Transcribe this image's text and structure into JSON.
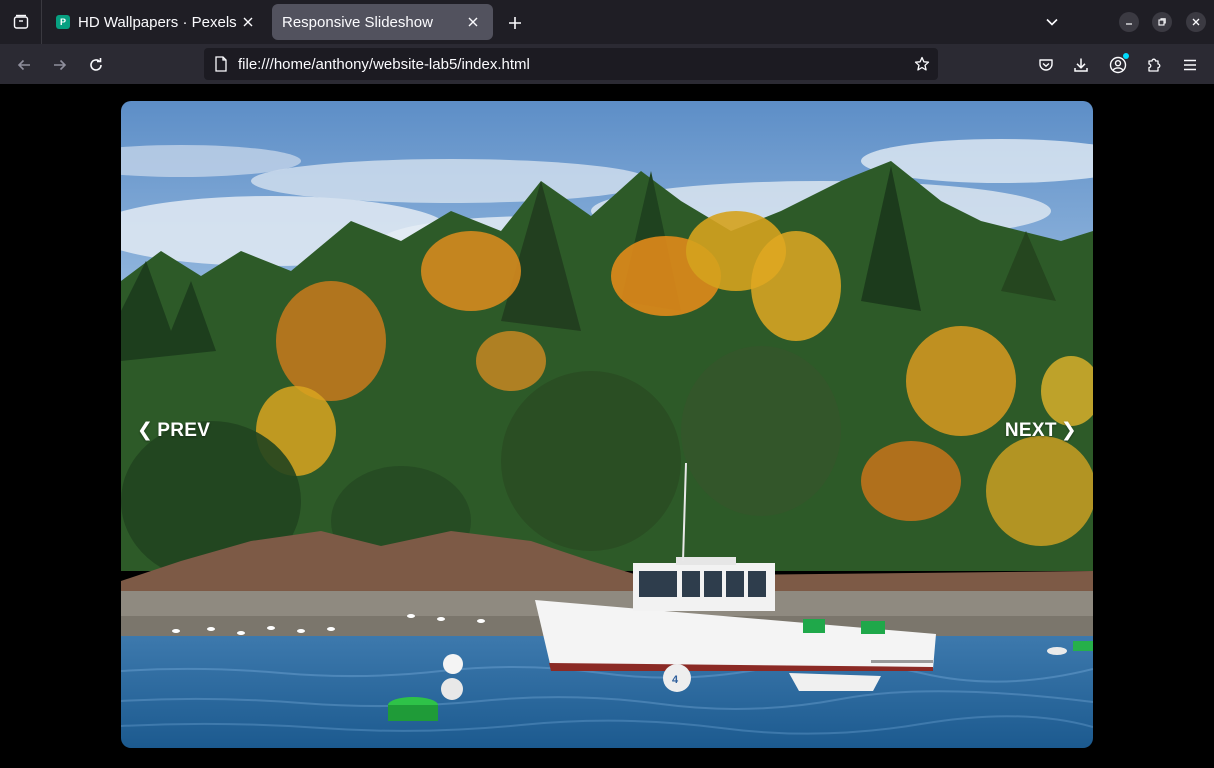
{
  "browser": {
    "tabs": [
      {
        "title": "HD Wallpapers · Pexels",
        "favicon_letter": "P",
        "active": false
      },
      {
        "title": "Responsive Slideshow",
        "active": true
      }
    ],
    "url": "file:///home/anthony/website-lab5/index.html"
  },
  "slideshow": {
    "prev_label": "PREV",
    "next_label": "NEXT",
    "prev_glyph": "❮",
    "next_glyph": "❯",
    "boat_number": "4"
  },
  "colors": {
    "tab_strip": "#1f1e25",
    "toolbar": "#2b2a33",
    "urlbar": "#1c1b22",
    "active_tab": "#52525e",
    "page_bg": "#000000"
  }
}
